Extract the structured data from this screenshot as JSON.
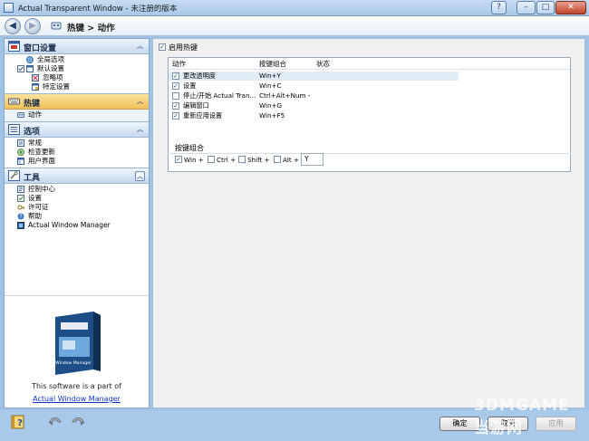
{
  "window": {
    "title": "Actual Transparent Window - 未注册的版本",
    "help_label": "?",
    "min_label": "–",
    "max_label": "□",
    "close_label": "✕"
  },
  "nav": {
    "back_glyph": "◀",
    "forward_glyph": "▶",
    "breadcrumb": "热键 > 动作"
  },
  "sidebar": {
    "sections": [
      {
        "title": "窗口设置",
        "icon": "window-settings-icon",
        "collapse_glyph": "︽",
        "items": [
          {
            "label": "全局选项",
            "icon": "globe-icon"
          },
          {
            "label": "默认设置",
            "icon": "checkbox-icon"
          },
          {
            "label": "忽略项",
            "icon": "ignore-icon"
          },
          {
            "label": "特定设置",
            "icon": "specific-settings-icon"
          }
        ]
      },
      {
        "title": "热键",
        "icon": "keyboard-icon",
        "collapse_glyph": "︽",
        "items": [
          {
            "label": "动作",
            "icon": "action-icon"
          }
        ]
      },
      {
        "title": "选项",
        "icon": "options-icon",
        "collapse_glyph": "︽",
        "items": [
          {
            "label": "常规",
            "icon": "general-icon"
          },
          {
            "label": "检查更新",
            "icon": "check-updates-icon"
          },
          {
            "label": "用户界面",
            "icon": "user-interface-icon"
          }
        ]
      },
      {
        "title": "工具",
        "icon": "tools-icon",
        "collapse_glyph": "︽",
        "items": [
          {
            "label": "控制中心",
            "icon": "control-center-icon"
          },
          {
            "label": "设置",
            "icon": "settings-check-icon"
          },
          {
            "label": "许可证",
            "icon": "license-icon"
          },
          {
            "label": "帮助",
            "icon": "help-icon"
          },
          {
            "label": "Actual Window Manager",
            "icon": "window-manager-icon"
          }
        ]
      }
    ],
    "promo": {
      "box_caption": "Window Manager",
      "text": "This software is a part of",
      "link": "Actual Window Manager"
    }
  },
  "main": {
    "enable_hotkeys": {
      "label": "启用热键",
      "checked": true
    },
    "table": {
      "columns": [
        "动作",
        "按键组合",
        "状态"
      ],
      "rows": [
        {
          "action": "更改透明度",
          "keys": "Win+Y",
          "checked": true,
          "selected": true
        },
        {
          "action": "设置",
          "keys": "Win+C",
          "checked": true,
          "selected": false
        },
        {
          "action": "停止/开始 Actual Tran...",
          "keys": "Ctrl+Alt+Num -",
          "checked": false,
          "selected": false
        },
        {
          "action": "编辑窗口",
          "keys": "Win+G",
          "checked": true,
          "selected": false
        },
        {
          "action": "重新应用设置",
          "keys": "Win+F5",
          "checked": true,
          "selected": false
        }
      ]
    },
    "combination": {
      "label": "按键组合",
      "modifiers": [
        {
          "label": "Win +",
          "checked": true
        },
        {
          "label": "Ctrl +",
          "checked": false
        },
        {
          "label": "Shift +",
          "checked": false
        },
        {
          "label": "Alt +",
          "checked": false
        }
      ],
      "key_value": "Y"
    }
  },
  "footer": {
    "ok_label": "确定",
    "cancel_label": "取消",
    "apply_label": "应用",
    "apply_disabled": true
  },
  "watermark": "3DMGAME 当游网"
}
